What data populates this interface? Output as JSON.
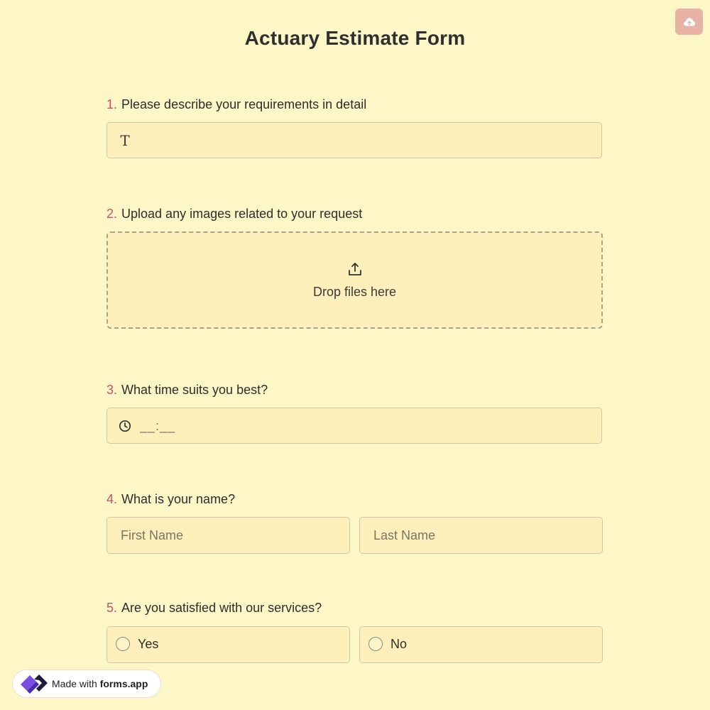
{
  "form": {
    "title": "Actuary Estimate Form",
    "save_icon": "cloud-upload-icon"
  },
  "questions": [
    {
      "number": "1.",
      "label": "Please describe your requirements in detail",
      "icon": "text-icon",
      "icon_glyph": "T"
    },
    {
      "number": "2.",
      "label": "Upload any images related to your request",
      "icon": "upload-icon",
      "drop_text": "Drop files here"
    },
    {
      "number": "3.",
      "label": "What time suits you best?",
      "icon": "clock-icon",
      "placeholder": "__:__"
    },
    {
      "number": "4.",
      "label": "What is your name?",
      "first_placeholder": "First Name",
      "last_placeholder": "Last Name"
    },
    {
      "number": "5.",
      "label": "Are you satisfied with our services?",
      "options": [
        "Yes",
        "No"
      ]
    }
  ],
  "badge": {
    "prefix": "Made with",
    "brand": "forms.app",
    "icon": "forms-app-logo"
  },
  "colors": {
    "background": "#fdf7c7",
    "field_background": "#fdf0bb",
    "accent_number": "#c0536d",
    "save_button": "#e8b2a4"
  }
}
